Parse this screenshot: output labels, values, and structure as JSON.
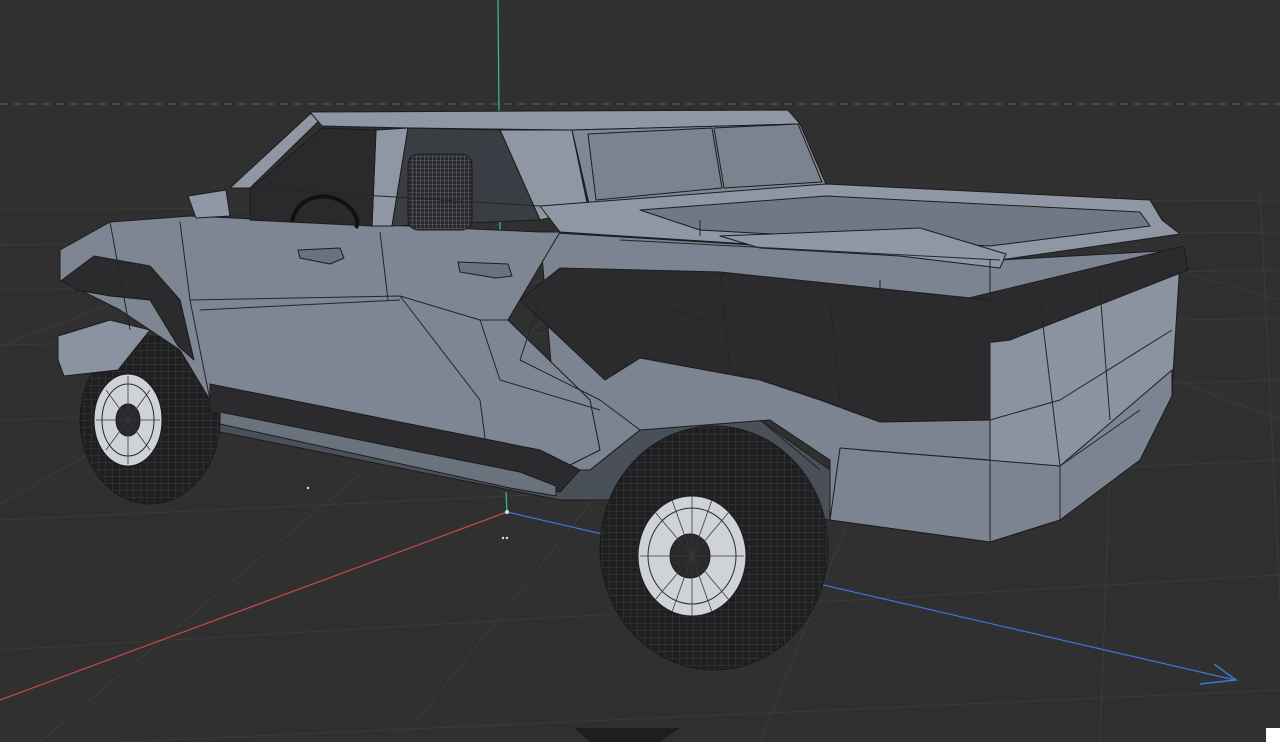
{
  "viewport": {
    "background": "#303031",
    "grid_color": "#3c3c3e",
    "horizon_color": "#6a6a6c"
  },
  "axes": {
    "x_axis_color": "#c24a4a",
    "y_axis_color": "#36c27a",
    "z_axis_color": "#3a78d8"
  },
  "model": {
    "body_color": "#7b8490",
    "body_light": "#8e97a3",
    "body_shadow": "#5d6570",
    "dark_panel_color": "#2b2b2d",
    "wire_color": "#1c1c1e",
    "tire_color": "#1f1f21",
    "rim_color": "#c9ccd1",
    "shading": "wireframe-on-shaded"
  }
}
